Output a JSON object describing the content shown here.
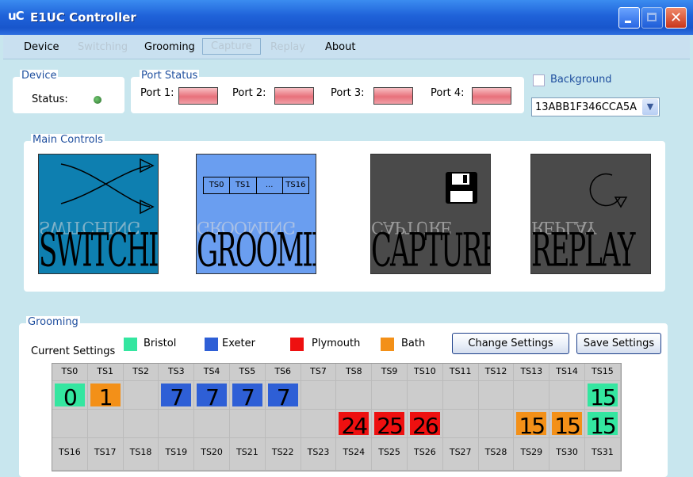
{
  "window": {
    "app_icon": "uC",
    "title": "E1UC Controller"
  },
  "menu": [
    {
      "label": "Device",
      "enabled": true
    },
    {
      "label": "Switching",
      "enabled": false
    },
    {
      "label": "Grooming",
      "enabled": true
    },
    {
      "label": "Capture",
      "enabled": false
    },
    {
      "label": "Replay",
      "enabled": false
    },
    {
      "label": "About",
      "enabled": true
    }
  ],
  "device": {
    "group_label": "Device",
    "status_label": "Status:"
  },
  "ports": {
    "group_label": "Port Status",
    "items": [
      {
        "label": "Port 1:"
      },
      {
        "label": "Port 2:"
      },
      {
        "label": "Port 3:"
      },
      {
        "label": "Port 4:"
      }
    ]
  },
  "background": {
    "label": "Background",
    "checked": false,
    "select_value": "13ABB1F346CCA5A"
  },
  "main_controls": {
    "group_label": "Main Controls",
    "tiles": [
      {
        "word": "SWITCHING",
        "icon": "switch-arrows-icon",
        "bg": "#0e7fb0"
      },
      {
        "word": "GROOMING",
        "icon": "timeslot-bar-icon",
        "bg": "#6a9ef0"
      },
      {
        "word": "CAPTURE",
        "icon": "floppy-disk-icon",
        "bg": "#4a4a4a"
      },
      {
        "word": "REPLAY",
        "icon": "replay-circle-icon",
        "bg": "#4a4a4a"
      }
    ],
    "grooming_strip": [
      "TS0",
      "TS1",
      "...",
      "TS16"
    ]
  },
  "grooming": {
    "group_label": "Grooming",
    "current_settings_label": "Current Settings",
    "legend": [
      {
        "name": "Bristol",
        "color": "#34e6a0"
      },
      {
        "name": "Exeter",
        "color": "#2e5fd6"
      },
      {
        "name": "Plymouth",
        "color": "#ee1010"
      },
      {
        "name": "Bath",
        "color": "#f39018"
      }
    ],
    "change_button": "Change Settings",
    "save_button": "Save Settings",
    "top_headers": [
      "TS0",
      "TS1",
      "TS2",
      "TS3",
      "TS4",
      "TS5",
      "TS6",
      "TS7",
      "TS8",
      "TS9",
      "TS10",
      "TS11",
      "TS12",
      "TS13",
      "TS14",
      "TS15"
    ],
    "bottom_headers": [
      "TS16",
      "TS17",
      "TS18",
      "TS19",
      "TS20",
      "TS21",
      "TS22",
      "TS23",
      "TS24",
      "TS25",
      "TS26",
      "TS27",
      "TS28",
      "TS29",
      "TS30",
      "TS31"
    ],
    "row1": [
      {
        "value": "0",
        "color": "#34e6a0"
      },
      {
        "value": "1",
        "color": "#f39018"
      },
      {
        "value": "",
        "color": ""
      },
      {
        "value": "7",
        "color": "#2e5fd6"
      },
      {
        "value": "7",
        "color": "#2e5fd6"
      },
      {
        "value": "7",
        "color": "#2e5fd6"
      },
      {
        "value": "7",
        "color": "#2e5fd6"
      },
      {
        "value": "",
        "color": ""
      },
      {
        "value": "",
        "color": ""
      },
      {
        "value": "",
        "color": ""
      },
      {
        "value": "",
        "color": ""
      },
      {
        "value": "",
        "color": ""
      },
      {
        "value": "",
        "color": ""
      },
      {
        "value": "",
        "color": ""
      },
      {
        "value": "",
        "color": ""
      },
      {
        "value": "15",
        "color": "#34e6a0"
      }
    ],
    "row2": [
      {
        "value": "",
        "color": ""
      },
      {
        "value": "",
        "color": ""
      },
      {
        "value": "",
        "color": ""
      },
      {
        "value": "",
        "color": ""
      },
      {
        "value": "",
        "color": ""
      },
      {
        "value": "",
        "color": ""
      },
      {
        "value": "",
        "color": ""
      },
      {
        "value": "",
        "color": ""
      },
      {
        "value": "24",
        "color": "#ee1010"
      },
      {
        "value": "25",
        "color": "#ee1010"
      },
      {
        "value": "26",
        "color": "#ee1010"
      },
      {
        "value": "",
        "color": ""
      },
      {
        "value": "",
        "color": ""
      },
      {
        "value": "15",
        "color": "#f39018"
      },
      {
        "value": "15",
        "color": "#f39018"
      },
      {
        "value": "15",
        "color": "#34e6a0"
      }
    ]
  }
}
